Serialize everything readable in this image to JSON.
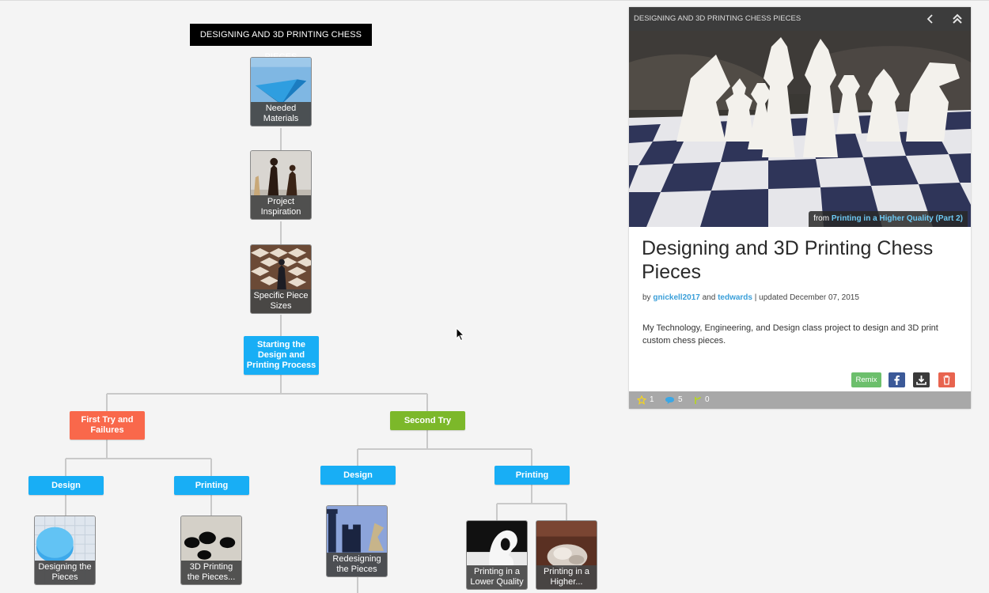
{
  "map": {
    "root_title": "DESIGNING AND 3D PRINTING CHESS PIECES",
    "cards": {
      "needed_materials": "Needed Materials",
      "project_inspiration": "Project Inspiration",
      "specific_piece_sizes": "Specific Piece Sizes",
      "designing_the_pieces": "Designing the Pieces",
      "printing_the_pieces": "3D Printing the Pieces...",
      "redesigning_the_pieces": "Redesigning the Pieces",
      "printing_lower_quality": "Printing in a Lower Quality",
      "printing_higher_quality": "Printing in a Higher..."
    },
    "nodes": {
      "starting": "Starting the Design and Printing Process",
      "first_try": "First Try and Failures",
      "second_try": "Second Try",
      "first_design": "Design",
      "first_printing": "Printing",
      "second_design": "Design",
      "second_printing": "Printing"
    }
  },
  "panel": {
    "header_title": "DESIGNING AND 3D PRINTING CHESS PIECES",
    "from_prefix": "from",
    "from_link": "Printing in a Higher Quality (Part 2)",
    "title": "Designing and 3D Printing Chess Pieces",
    "by": "by",
    "author1": "gnickell2017",
    "and": "and",
    "author2": "tedwards",
    "updated": "| updated December 07, 2015",
    "description": "My Technology, Engineering, and Design class project to design and 3D print custom chess pieces.",
    "remix_label": "Remix",
    "stats": {
      "favorites": "1",
      "comments": "5",
      "remixes": "0"
    }
  },
  "colors": {
    "node_blue": "#18aef5",
    "node_orange": "#f9684b",
    "node_green": "#7cb82a",
    "link": "#3a9fd9"
  },
  "icons": [
    "back-chevron-icon",
    "collapse-up-icon",
    "facebook-icon",
    "download-icon",
    "trash-icon",
    "star-icon",
    "comment-icon",
    "remix-icon",
    "mouse-cursor-icon"
  ]
}
